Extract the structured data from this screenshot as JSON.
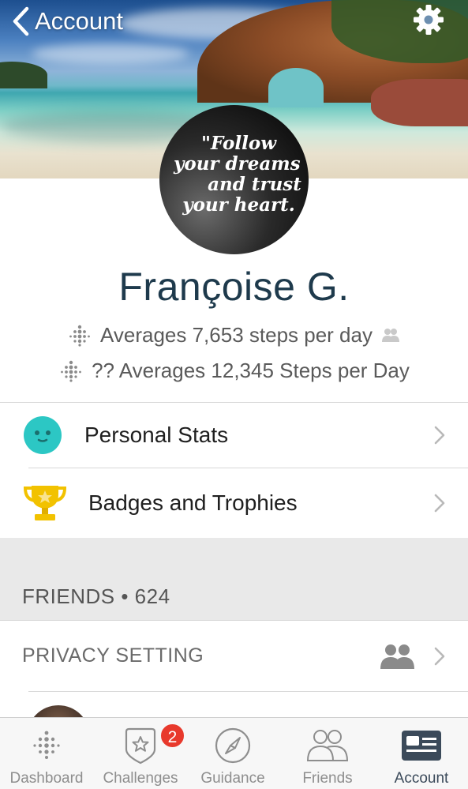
{
  "header": {
    "back_label": "Account",
    "back_icon": "chevron-left-icon",
    "settings_icon": "gear-icon"
  },
  "profile": {
    "avatar_quote": [
      "\"Follow",
      "your dreams",
      "and trust",
      "your heart."
    ],
    "name": "Françoise G.",
    "stats": [
      {
        "icon": "fitbit-dots-icon",
        "text": "Averages 7,653 steps per day",
        "trailing_icon": "friends-icon"
      },
      {
        "icon": "fitbit-dots-icon",
        "text": "?? Averages 12,345 Steps per Day"
      }
    ]
  },
  "menu": [
    {
      "label": "Personal Stats",
      "icon": "personal-stats-icon"
    },
    {
      "label": "Badges and Trophies",
      "icon": "trophy-icon"
    }
  ],
  "friends_section": {
    "header": "FRIENDS • 624",
    "privacy_label": "PRIVACY SETTING"
  },
  "tabbar": {
    "tabs": [
      {
        "label": "Dashboard",
        "icon": "fitbit-dots-icon"
      },
      {
        "label": "Challenges",
        "icon": "star-badge-icon",
        "badge": "2"
      },
      {
        "label": "Guidance",
        "icon": "compass-icon"
      },
      {
        "label": "Friends",
        "icon": "friends-icon"
      },
      {
        "label": "Account",
        "icon": "id-card-icon"
      }
    ],
    "active": "Account"
  },
  "colors": {
    "name": "#1e3a4c",
    "stats_icon_bg": "#2cc7c4",
    "trophy": "#f2c200",
    "badge": "#e8392c",
    "band": "#e9e9e9"
  }
}
